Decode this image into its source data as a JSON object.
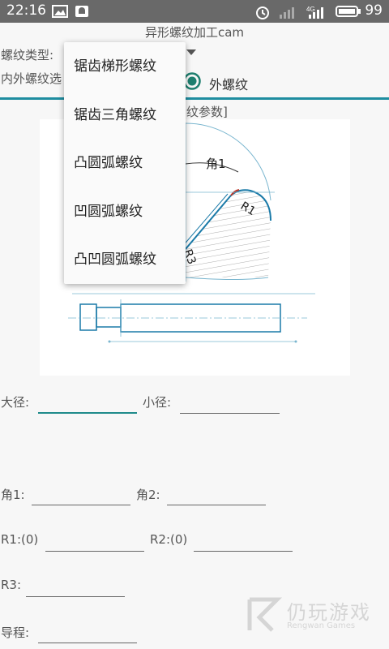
{
  "status_bar": {
    "time": "22:16",
    "battery_level": "99",
    "network_label": "4G",
    "icons": [
      "image-icon",
      "notification-icon",
      "alarm-icon",
      "signal-icon",
      "signal-4g-icon",
      "battery-icon"
    ]
  },
  "app": {
    "title": "异形螺纹加工cam"
  },
  "form": {
    "thread_type_label": "螺纹类型:",
    "inner_outer_label": "内外螺纹选",
    "outer_thread_option": "外螺纹",
    "outer_thread_selected": true,
    "params_header": "纹参数]",
    "major_diameter_label": "大径:",
    "minor_diameter_label": "小径:",
    "angle1_label": "角1:",
    "angle2_label": "角2:",
    "r1_label": "R1:(0)",
    "r2_label": "R2:(0)",
    "r3_label": "R3:",
    "lead_label": "导程:"
  },
  "dropdown_menu": {
    "items": [
      "锯齿梯形螺纹",
      "锯齿三角螺纹",
      "凸圆弧螺纹",
      "凹圆弧螺纹",
      "凸凹圆弧螺纹"
    ]
  },
  "drawing": {
    "angle_label": "角1",
    "r1_label": "R1",
    "r3_label": "R3"
  },
  "watermark": {
    "text": "仍玩游戏",
    "subtext": "Rengwan Games"
  },
  "colors": {
    "accent": "#1e8da0",
    "status_bar": "#696969",
    "background": "#f7f7f7",
    "drawing_line": "#1a7aa8"
  }
}
